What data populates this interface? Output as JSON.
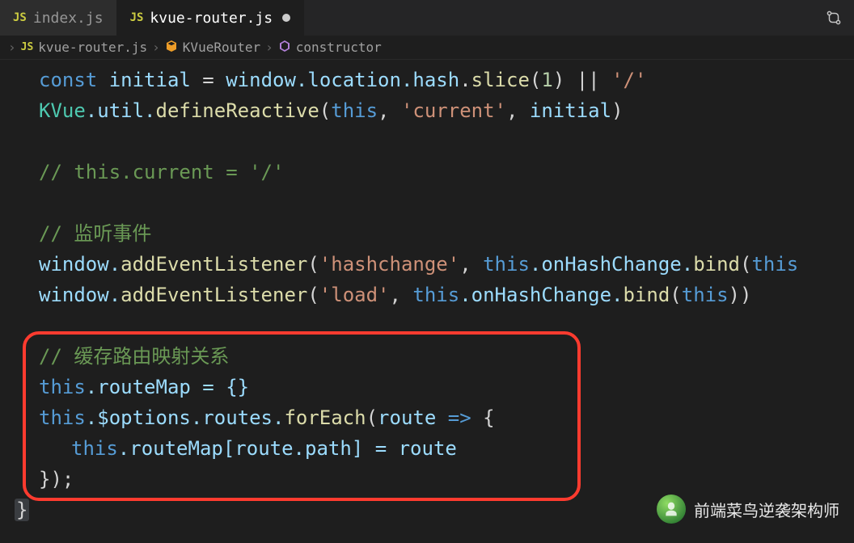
{
  "tabs": [
    {
      "label": "index.js",
      "active": false,
      "dirty": false
    },
    {
      "label": "kvue-router.js",
      "active": true,
      "dirty": true
    }
  ],
  "breadcrumb": {
    "file": "kvue-router.js",
    "class": "KVueRouter",
    "method": "constructor"
  },
  "code": {
    "l1_kw": "const",
    "l1_var": "initial",
    "l1_eq": " = ",
    "l1_loc": "window.location.hash",
    "l1_slice": "slice",
    "l1_num": "1",
    "l1_or": " || ",
    "l1_str": "'/'",
    "l2_kvue": "KVue",
    "l2_util": ".util.",
    "l2_def": "defineReactive",
    "l2_this": "this",
    "l2_s1": ", ",
    "l2_str": "'current'",
    "l2_s2": ", ",
    "l2_init": "initial",
    "l4_cmt": "// this.current = '/'",
    "l6_cmt": "// 监听事件",
    "l7_win": "window.",
    "l7_add": "addEventListener",
    "l7_str": "'hashchange'",
    "l7_sep": ", ",
    "l7_this": "this",
    "l7_on": ".onHashChange.",
    "l7_bind": "bind",
    "l7_this2": "this",
    "l8_str": "'load'",
    "l8_this": "this",
    "l8_on": ".onHashChange.",
    "l8_bind": "bind",
    "l8_this2": "this",
    "l10_cmt": "// 缓存路由映射关系",
    "l11_this": "this",
    "l11_rm": ".routeMap = {}",
    "l12_this": "this",
    "l12_opt": ".$options.routes.",
    "l12_fe": "forEach",
    "l12_route": "route",
    "l12_arrow": " => ",
    "l13_this": "this",
    "l13_rm": ".routeMap[",
    "l13_route": "route",
    "l13_path": ".path] = ",
    "l13_route2": "route",
    "l14_close": "});",
    "l15_brace": "}"
  },
  "watermark": {
    "text": "前端菜鸟逆袭架构师"
  }
}
